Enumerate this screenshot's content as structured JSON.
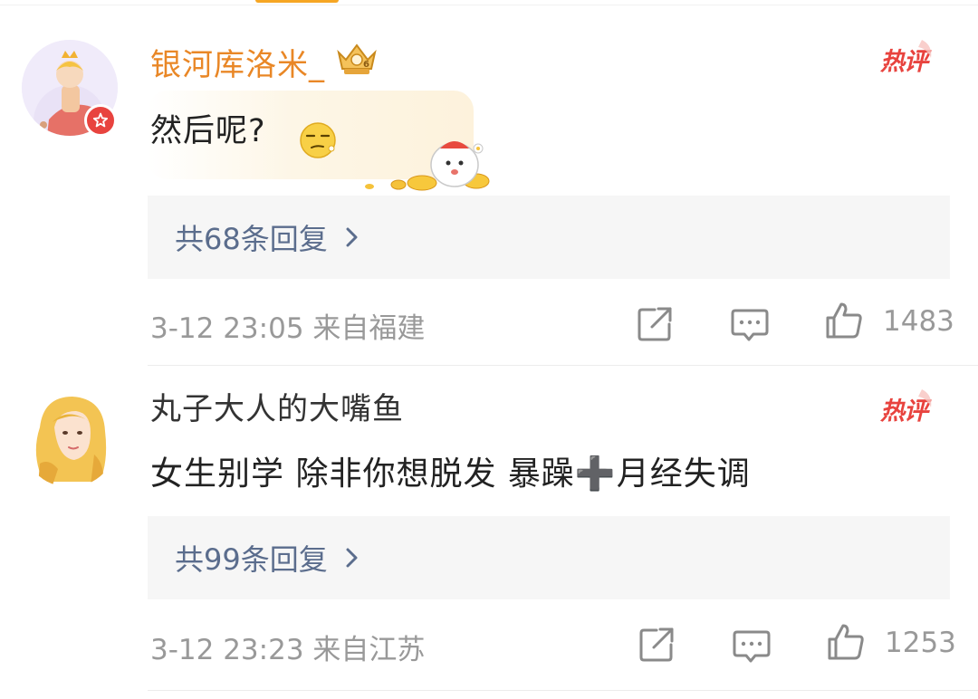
{
  "comments": [
    {
      "username": "银河库洛米_",
      "hot_label": "热评",
      "text": "然后呢?",
      "replies": "共68条回复",
      "meta": "3-12 23:05 来自福建",
      "likes": "1483",
      "icons": [
        "avatar-princess",
        "vip-crown-icon",
        "share-icon",
        "comment-icon",
        "like-icon"
      ]
    },
    {
      "username": "丸子大人的大嘴鱼",
      "hot_label": "热评",
      "text": "女生别学 除非你想脱发 暴躁➕月经失调",
      "replies": "共99条回复",
      "meta": "3-12 23:23 来自江苏",
      "likes": "1253",
      "icons": [
        "avatar-blonde-girl",
        "share-icon",
        "comment-icon",
        "like-icon"
      ]
    }
  ],
  "colors": {
    "username_highlight": "#e98726",
    "hot_red": "#e8433e",
    "reply_link": "#5b6d8d",
    "meta_gray": "#999999",
    "reply_box_bg": "#f6f6f6"
  }
}
